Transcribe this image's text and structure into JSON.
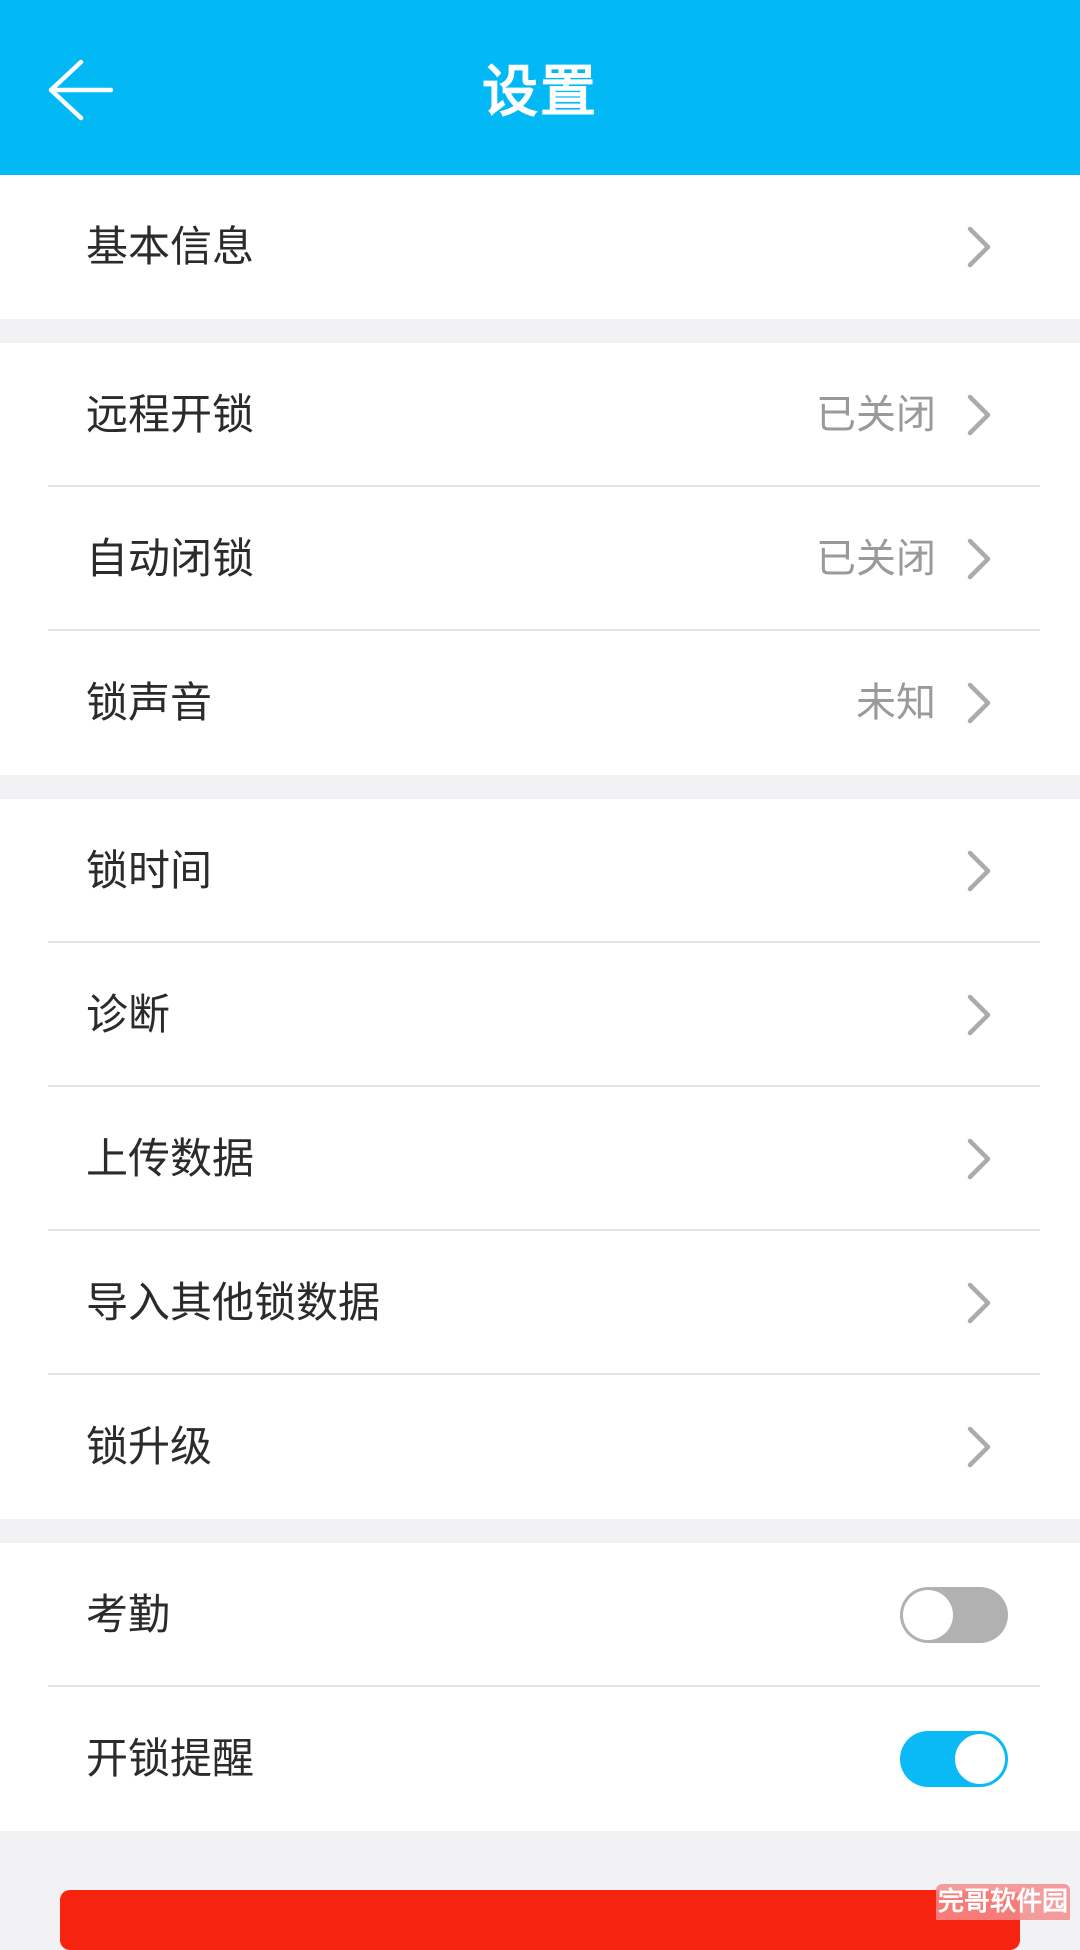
{
  "header": {
    "title": "设置",
    "color": "#02b8f5"
  },
  "groups": [
    {
      "items": [
        {
          "label": "基本信息",
          "value": ""
        }
      ]
    },
    {
      "items": [
        {
          "label": "远程开锁",
          "value": "已关闭"
        },
        {
          "label": "自动闭锁",
          "value": "已关闭"
        },
        {
          "label": "锁声音",
          "value": "未知"
        }
      ]
    },
    {
      "items": [
        {
          "label": "锁时间",
          "value": ""
        },
        {
          "label": "诊断",
          "value": ""
        },
        {
          "label": "上传数据",
          "value": ""
        },
        {
          "label": "导入其他锁数据",
          "value": ""
        },
        {
          "label": "锁升级",
          "value": ""
        }
      ]
    },
    {
      "items": [
        {
          "label": "考勤",
          "toggle": "off"
        },
        {
          "label": "开锁提醒",
          "toggle": "on"
        }
      ]
    }
  ],
  "icons": {
    "back": "arrow-left-icon",
    "chevron": "chevron-right-icon"
  },
  "colors": {
    "accent": "#02b8f5",
    "toggle_on": "#0abaf6",
    "toggle_off": "#b1b1b1",
    "danger_button": "#f5230f"
  },
  "watermark": {
    "text": "完哥软件园"
  }
}
